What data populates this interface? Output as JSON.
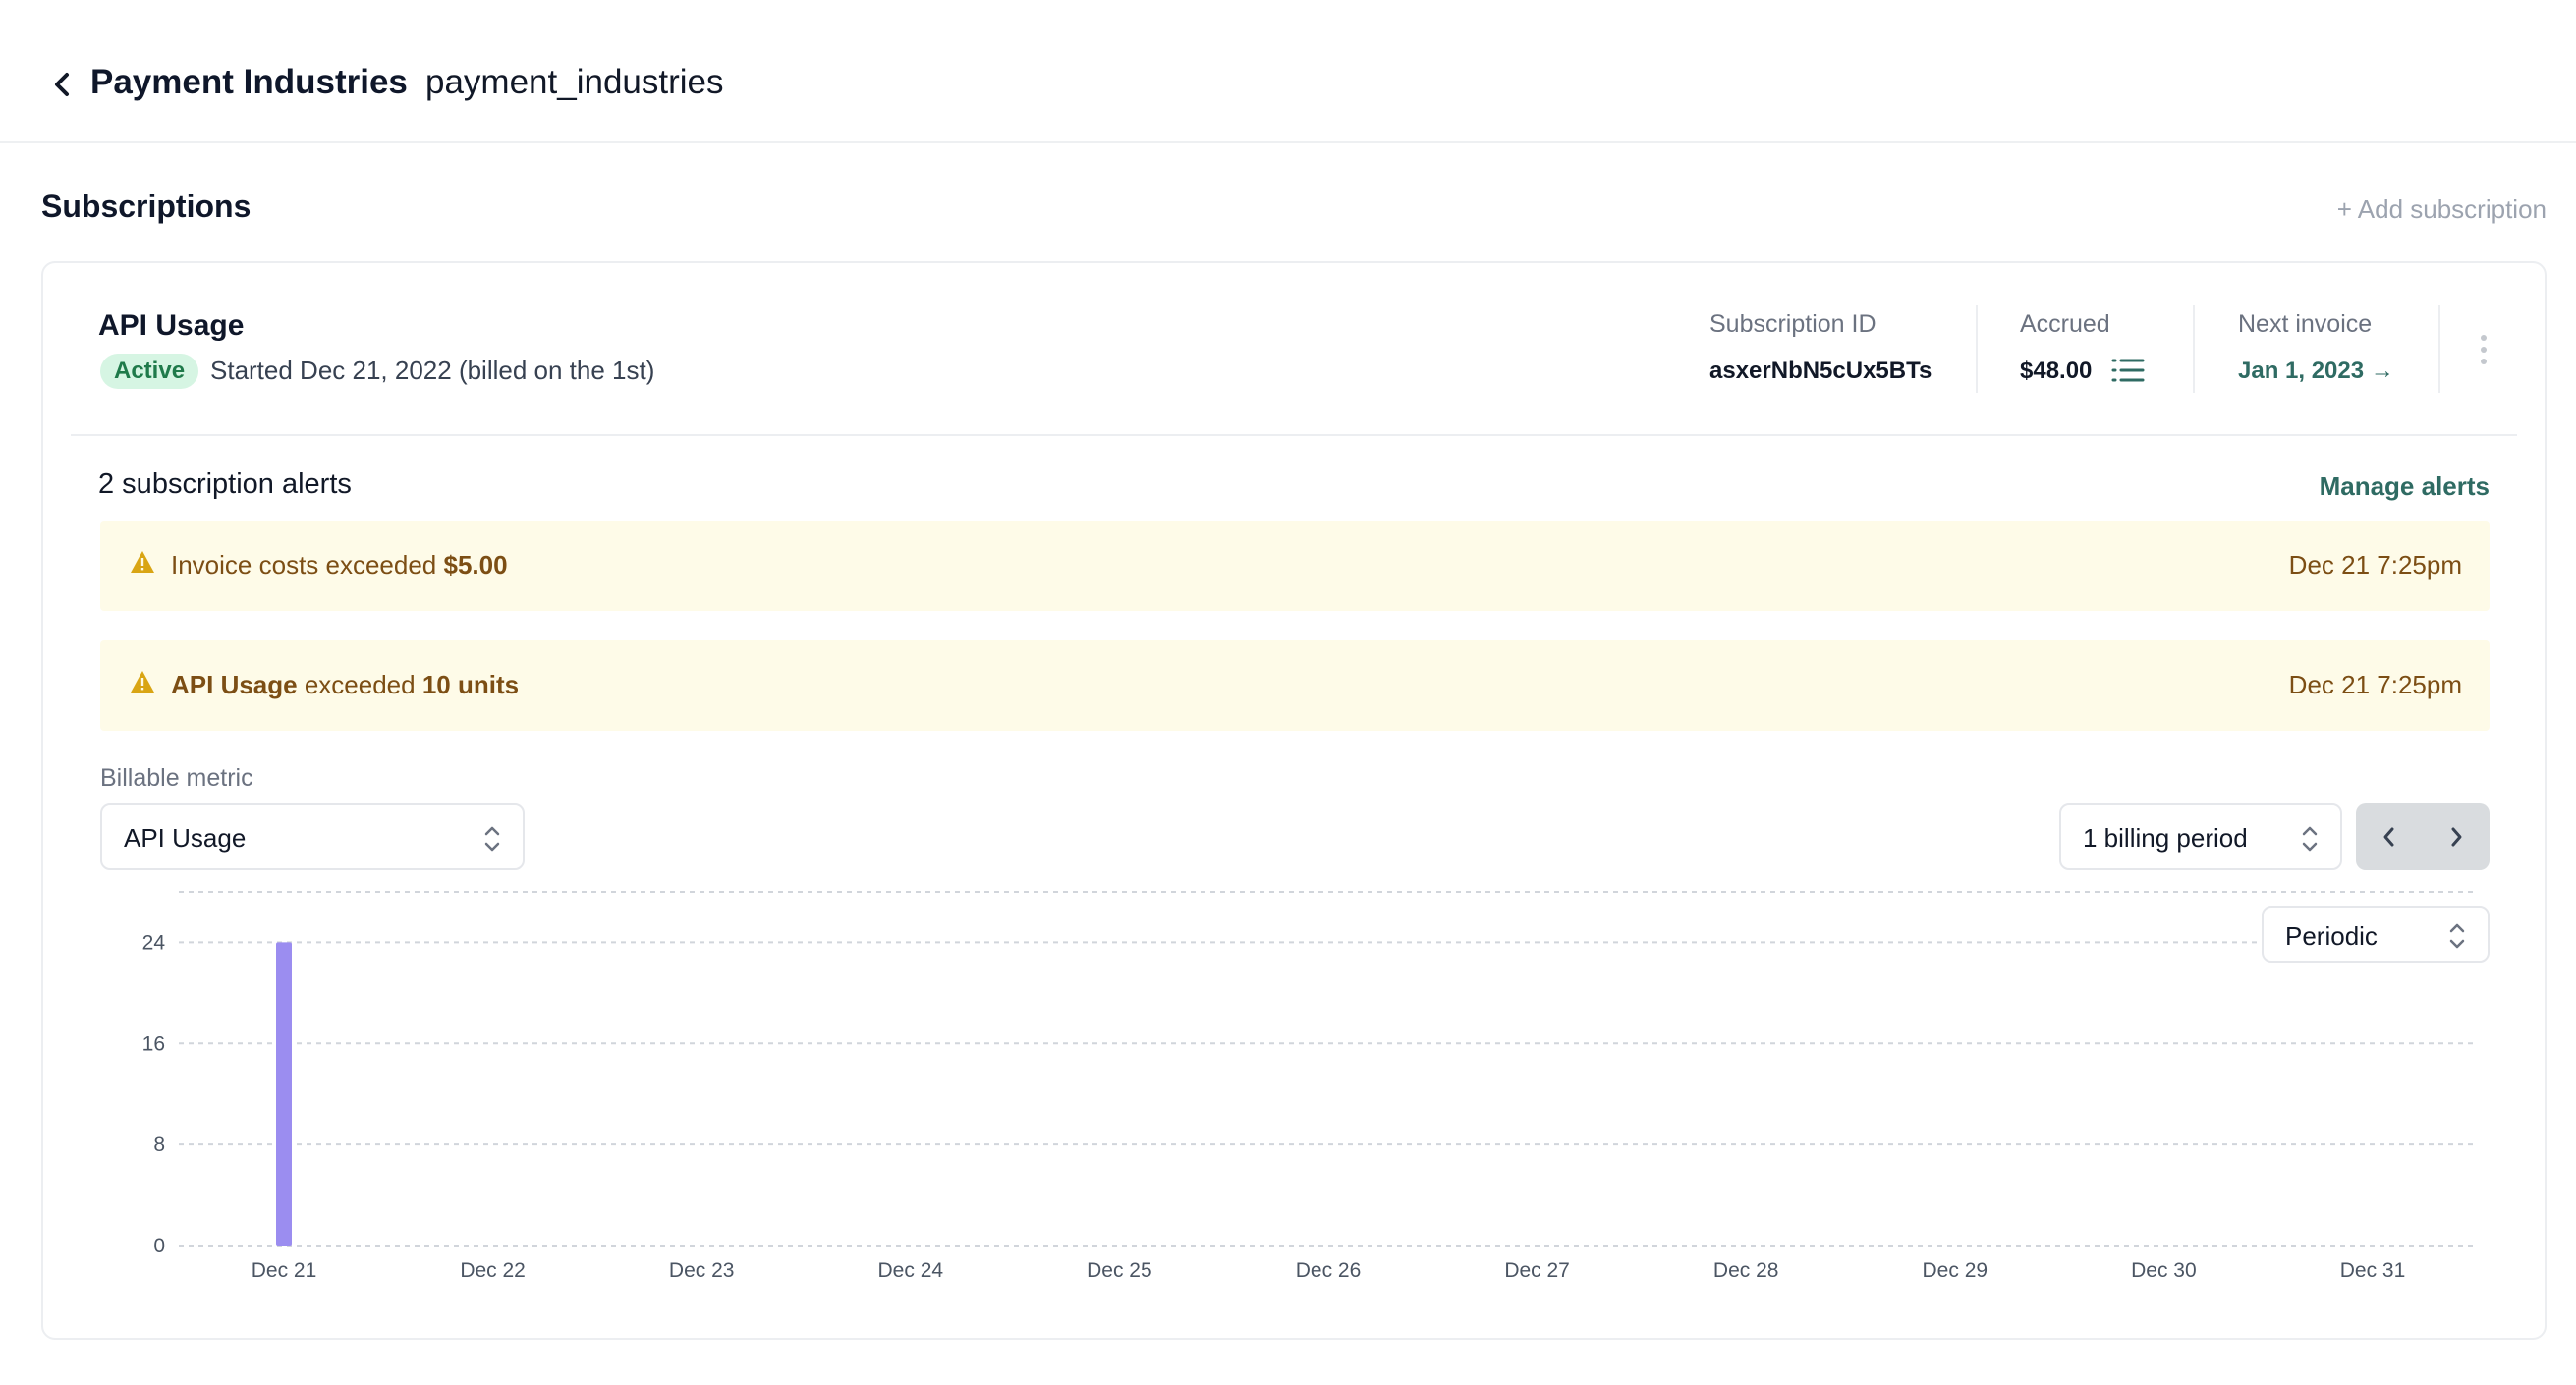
{
  "header": {
    "customer_name": "Payment Industries",
    "customer_slug": "payment_industries"
  },
  "section": {
    "title": "Subscriptions",
    "add_label": "+ Add subscription"
  },
  "subscription": {
    "plan_name": "API Usage",
    "status": "Active",
    "started": "Started Dec 21, 2022 (billed on the 1st)",
    "subscription_id_label": "Subscription ID",
    "subscription_id": "asxerNbN5cUx5BTs",
    "accrued_label": "Accrued",
    "accrued": "$48.00",
    "next_invoice_label": "Next invoice",
    "next_invoice": "Jan 1, 2023 →"
  },
  "alerts": {
    "title": "2 subscription alerts",
    "manage_label": "Manage alerts",
    "items": [
      {
        "pre": "Invoice costs exceeded ",
        "bold_prefix": "",
        "bold": "$5.00",
        "time": "Dec 21 7:25pm"
      },
      {
        "pre": " exceeded ",
        "bold_prefix": "API Usage",
        "bold": "10 units",
        "time": "Dec 21 7:25pm"
      }
    ]
  },
  "controls": {
    "metric_label": "Billable metric",
    "metric_value": "API Usage",
    "period_value": "1 billing period",
    "mode_value": "Periodic"
  },
  "colors": {
    "accent": "#2f6b63",
    "bar": "#9b8df0",
    "active_badge_bg": "#d6f5e3",
    "alert_bg": "#fefbe8",
    "alert_text": "#7c4e14",
    "warn_icon": "#d9a514"
  },
  "icons": {
    "back": "chevron-left-icon",
    "list": "list-icon",
    "more": "more-vertical-icon",
    "warning": "warning-triangle-icon",
    "select": "chevron-up-down-icon",
    "prev": "chevron-left-icon",
    "next": "chevron-right-icon"
  },
  "chart_data": {
    "type": "bar",
    "categories": [
      "Dec 21",
      "Dec 22",
      "Dec 23",
      "Dec 24",
      "Dec 25",
      "Dec 26",
      "Dec 27",
      "Dec 28",
      "Dec 29",
      "Dec 30",
      "Dec 31"
    ],
    "values": [
      24,
      0,
      0,
      0,
      0,
      0,
      0,
      0,
      0,
      0,
      0
    ],
    "yticks": [
      0,
      8,
      16,
      24
    ],
    "ylim": [
      0,
      28
    ],
    "grid": true,
    "title": "",
    "xlabel": "",
    "ylabel": ""
  }
}
